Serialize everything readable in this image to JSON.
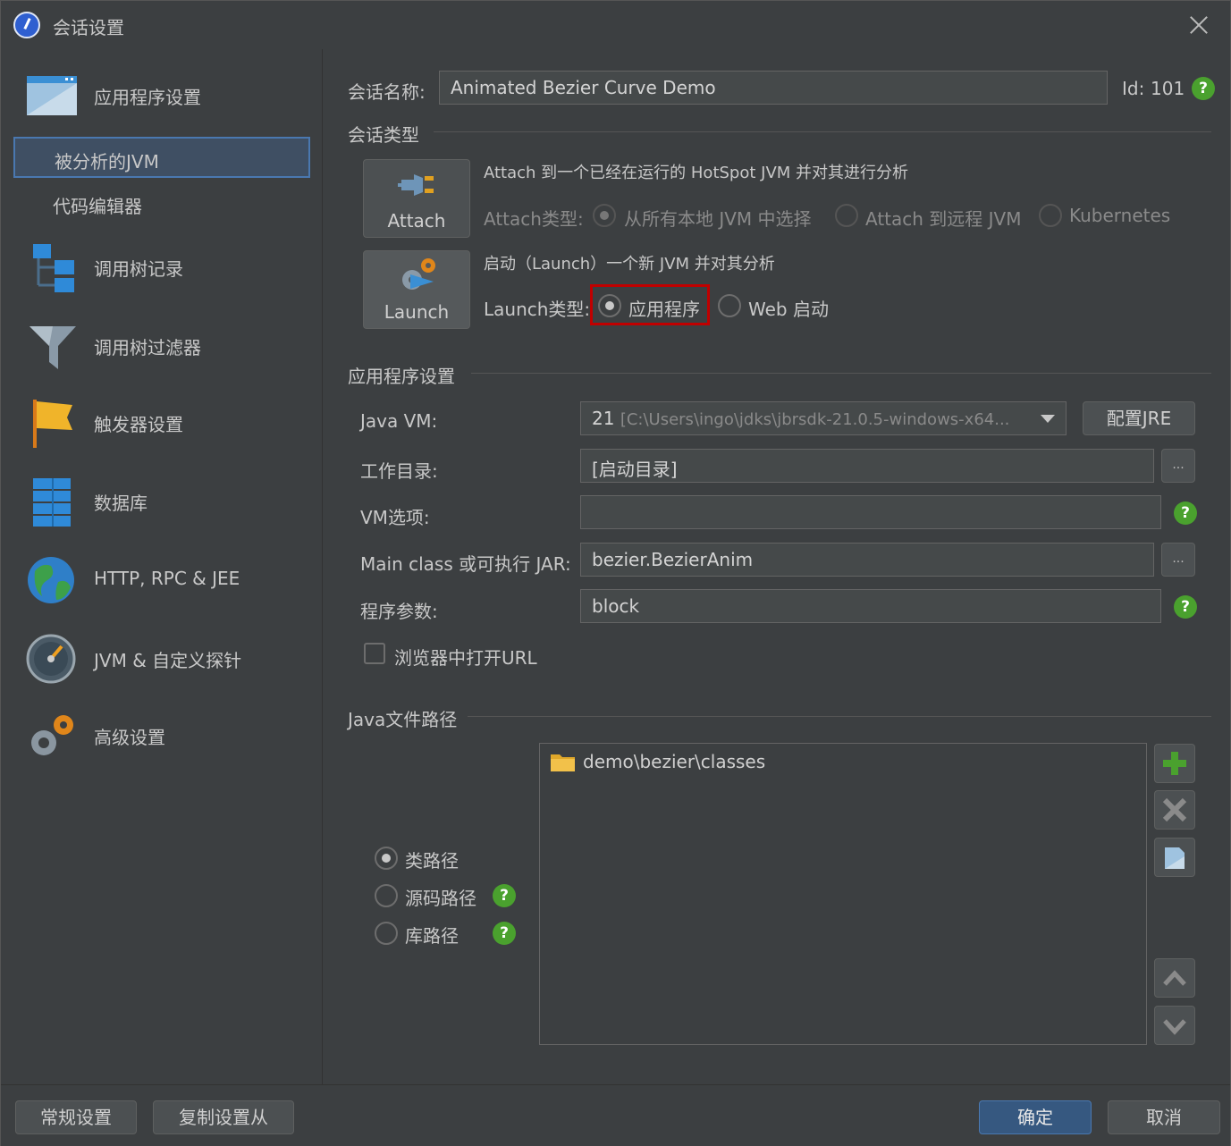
{
  "window": {
    "title": "会话设置"
  },
  "sidebar": {
    "items": [
      {
        "label": "应用程序设置",
        "icon": "window-icon"
      },
      {
        "label": "被分析的JVM",
        "sub": true,
        "selected": true
      },
      {
        "label": "代码编辑器",
        "sub": true
      },
      {
        "label": "调用树记录",
        "icon": "call-tree-icon"
      },
      {
        "label": "调用树过滤器",
        "icon": "filter-icon"
      },
      {
        "label": "触发器设置",
        "icon": "flag-icon"
      },
      {
        "label": "数据库",
        "icon": "database-icon"
      },
      {
        "label": "HTTP, RPC & JEE",
        "icon": "globe-icon"
      },
      {
        "label": "JVM & 自定义探针",
        "icon": "gauge-icon"
      },
      {
        "label": "高级设置",
        "icon": "gears-icon"
      }
    ]
  },
  "session": {
    "name_label": "会话名称:",
    "name_value": "Animated Bezier Curve Demo",
    "id_label": "Id:",
    "id_value": "101"
  },
  "session_type": {
    "section_title": "会话类型",
    "attach_button": "Attach",
    "attach_desc": "Attach 到一个已经在运行的 HotSpot JVM 并对其进行分析",
    "attach_type_label": "Attach类型:",
    "attach_options": [
      "从所有本地 JVM 中选择",
      "Attach 到远程 JVM",
      "Kubernetes"
    ],
    "launch_button": "Launch",
    "launch_desc": "启动（Launch）一个新 JVM 并对其分析",
    "launch_type_label": "Launch类型:",
    "launch_options": [
      "应用程序",
      "Web 启动"
    ]
  },
  "app_settings": {
    "section_title": "应用程序设置",
    "java_vm_label": "Java VM:",
    "java_vm_version": "21",
    "java_vm_path": "[C:\\Users\\ingo\\jdks\\jbrsdk-21.0.5-windows-x64...",
    "configure_jre": "配置JRE",
    "workdir_label": "工作目录:",
    "workdir_value": "[启动目录]",
    "vm_options_label": "VM选项:",
    "vm_options_value": "",
    "main_class_label": "Main class 或可执行 JAR:",
    "main_class_value": "bezier.BezierAnim",
    "args_label": "程序参数:",
    "args_value": "block",
    "browse_label": "...",
    "open_url_label": "浏览器中打开URL"
  },
  "java_paths": {
    "section_title": "Java文件路径",
    "options": [
      "类路径",
      "源码路径",
      "库路径"
    ],
    "entries": [
      "demo\\bezier\\classes"
    ]
  },
  "footer": {
    "general_settings": "常规设置",
    "copy_settings": "复制设置从",
    "ok": "确定",
    "cancel": "取消"
  },
  "colors": {
    "accent": "#4a78b0",
    "highlight": "#c00000",
    "help": "#4aa12e"
  }
}
